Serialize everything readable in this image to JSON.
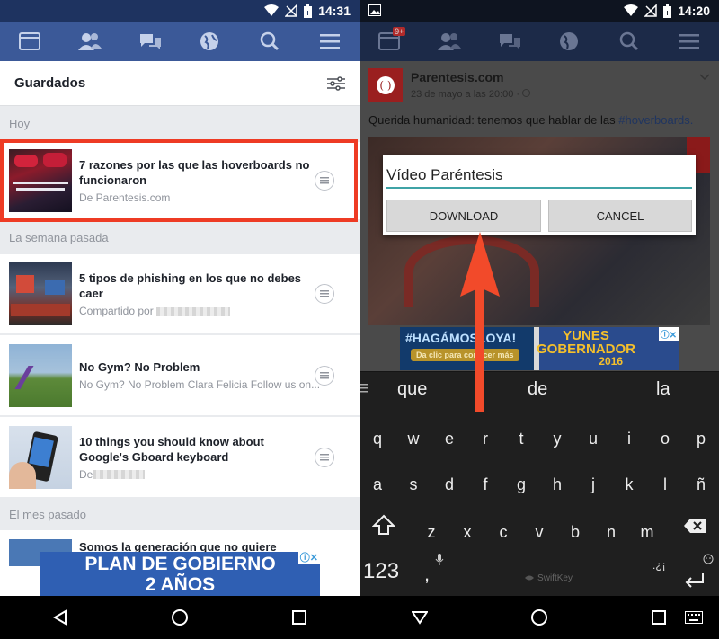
{
  "left": {
    "status_time": "14:31",
    "nav_icons": [
      "news-feed-icon",
      "friends-icon",
      "messages-icon",
      "globe-icon",
      "search-icon",
      "menu-icon"
    ],
    "header_title": "Guardados",
    "sections": {
      "today": "Hoy",
      "last_week": "La semana pasada",
      "last_month": "El mes pasado"
    },
    "items": [
      {
        "title": "7 razones por las que las hoverboards no funcionaron",
        "subtitle": "De Parentesis.com"
      },
      {
        "title": "5 tipos de phishing en los que no debes caer",
        "subtitle": "Compartido por"
      },
      {
        "title": "No Gym? No Problem",
        "subtitle": "No Gym? No Problem Clara Felicia Follow us on..."
      },
      {
        "title": "10 things you should know about Google's Gboard keyboard",
        "subtitle": "De"
      },
      {
        "title": "Somos la generación que no quiere"
      }
    ],
    "ad_line1": "PLAN DE GOBIERNO",
    "ad_line2": "2 AÑOS"
  },
  "right": {
    "status_time": "14:20",
    "notification_badge": "9+",
    "post": {
      "page_name": "Parentesis.com",
      "date": "23 de mayo a las 20:00 · ",
      "text_before": "Querida humanidad: tenemos que hablar de las ",
      "hashtag": "#hoverboards."
    },
    "dialog": {
      "input_value": "Vídeo Paréntesis",
      "download_label": "DOWNLOAD",
      "cancel_label": "CANCEL"
    },
    "ad": {
      "left_text": "#HAGÁMOSLOYA!",
      "left_sub": "Da clic para conocer más",
      "right_line1": "YUNES",
      "right_line2": "GOBERNADOR",
      "year": "2016"
    },
    "keyboard": {
      "suggestions": [
        "que",
        "de",
        "la"
      ],
      "row1": [
        "q",
        "w",
        "e",
        "r",
        "t",
        "y",
        "u",
        "i",
        "o",
        "p"
      ],
      "row2": [
        "a",
        "s",
        "d",
        "f",
        "g",
        "h",
        "j",
        "k",
        "l",
        "ñ"
      ],
      "row3": [
        "z",
        "x",
        "c",
        "v",
        "b",
        "n",
        "m"
      ],
      "numbers_label": "123",
      "comma": ",",
      "punct": ".¿¡",
      "brand": "SwiftKey"
    }
  },
  "colors": {
    "facebook_blue": "#3b5998",
    "highlight_red": "#ee3b24",
    "arrow_red": "#f24a2a",
    "input_underline": "#3fa3a6"
  }
}
